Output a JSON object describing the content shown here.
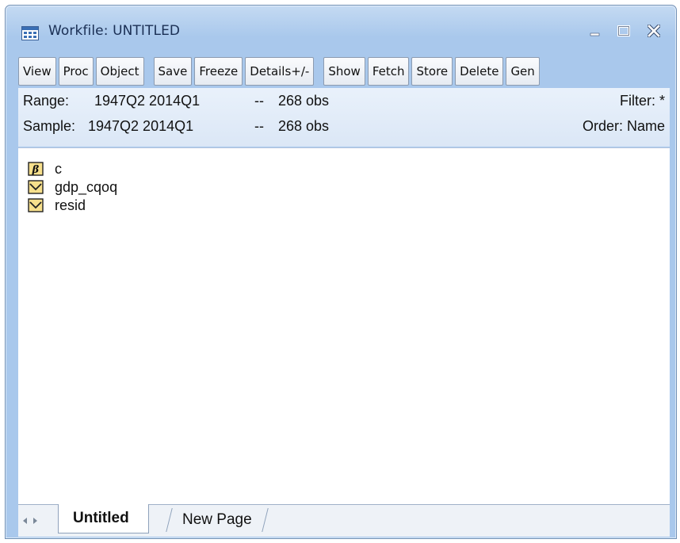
{
  "window": {
    "title": "Workfile: UNTITLED",
    "minimize_label": "_",
    "maximize_label": "□",
    "close_label": "X"
  },
  "toolbar": {
    "buttons": [
      "View",
      "Proc",
      "Object",
      "Save",
      "Freeze",
      "Details+/-",
      "Show",
      "Fetch",
      "Store",
      "Delete",
      "Gen"
    ]
  },
  "info": {
    "range_label": "Range:",
    "range_value": "1947Q2 2014Q1",
    "range_sep": "--",
    "range_obs": "268 obs",
    "filter": "Filter: *",
    "sample_label": "Sample:",
    "sample_value": "1947Q2 2014Q1",
    "sample_sep": "--",
    "sample_obs": "268 obs",
    "order": "Order: Name"
  },
  "objects": [
    {
      "name": "c",
      "icon": "coefficient-icon"
    },
    {
      "name": "gdp_cqoq",
      "icon": "series-icon"
    },
    {
      "name": "resid",
      "icon": "series-icon"
    }
  ],
  "tabs": {
    "active": "Untitled",
    "inactive": "New Page"
  },
  "colors": {
    "title_bar": "#a9c8ec",
    "icon_fill": "#f7e08c"
  }
}
